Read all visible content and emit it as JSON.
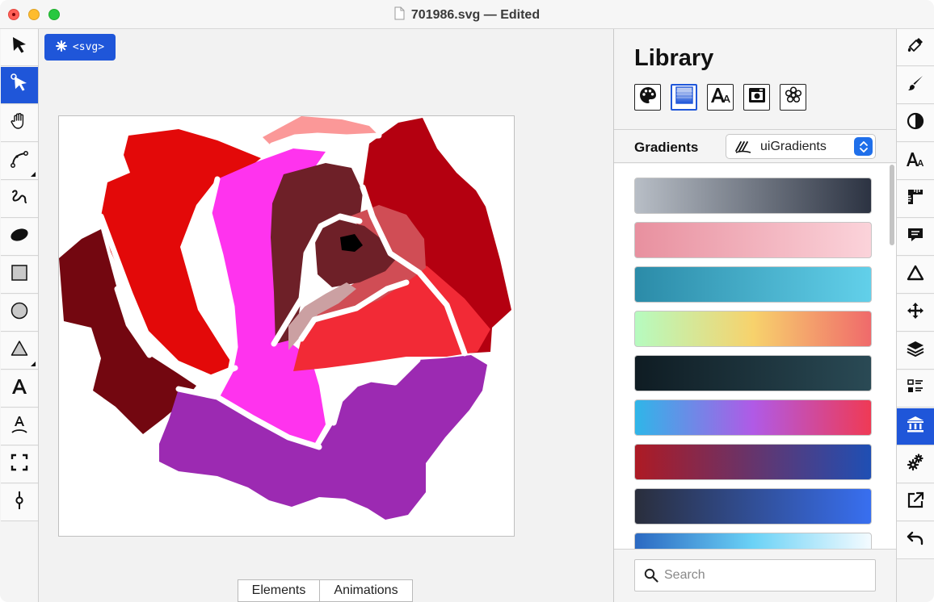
{
  "window": {
    "title": "701986.svg — Edited"
  },
  "left_toolbar": {
    "tools": [
      {
        "name": "select-arrow",
        "icon": "arrow-pointer-icon",
        "active": false
      },
      {
        "name": "node-select",
        "icon": "node-pointer-icon",
        "active": true
      },
      {
        "name": "pan-hand",
        "icon": "hand-icon",
        "active": false
      },
      {
        "name": "pen",
        "icon": "bezier-pen-icon",
        "active": false
      },
      {
        "name": "freehand",
        "icon": "squiggle-icon",
        "active": false
      },
      {
        "name": "ellipse",
        "icon": "ellipse-icon",
        "active": false
      },
      {
        "name": "rectangle",
        "icon": "rectangle-icon",
        "active": false
      },
      {
        "name": "circle",
        "icon": "circle-icon",
        "active": false
      },
      {
        "name": "polygon",
        "icon": "triangle-icon",
        "active": false
      },
      {
        "name": "text",
        "icon": "text-icon",
        "active": false
      },
      {
        "name": "text-path",
        "icon": "text-on-path-icon",
        "active": false
      },
      {
        "name": "zoom-fit",
        "icon": "fit-frame-icon",
        "active": false
      },
      {
        "name": "gradient-stop",
        "icon": "stop-handle-icon",
        "active": false
      }
    ]
  },
  "canvas": {
    "element_chip": "<svg>",
    "bottom_tabs": [
      "Elements",
      "Animations"
    ]
  },
  "library": {
    "title": "Library",
    "categories": [
      {
        "name": "colors",
        "icon": "palette-icon",
        "active": false
      },
      {
        "name": "gradients",
        "icon": "gradient-swatch-icon",
        "active": true
      },
      {
        "name": "fonts",
        "icon": "font-icon",
        "active": false
      },
      {
        "name": "images",
        "icon": "image-icon",
        "active": false
      },
      {
        "name": "symbols",
        "icon": "flower-icon",
        "active": false
      }
    ],
    "section_label": "Gradients",
    "source_select": "uiGradients",
    "search_placeholder": "Search",
    "gradients": [
      {
        "from": "#b8bec6",
        "to": "#2c3342"
      },
      {
        "from": "#e8909f",
        "to": "#fbd3da"
      },
      {
        "from": "#2b8ba8",
        "to": "#62d0ea"
      },
      {
        "from": "#b6fbc0",
        "mid": "#f7d26c",
        "to": "#f06a6b"
      },
      {
        "from": "#0f1c23",
        "to": "#2a4a55"
      },
      {
        "from": "#2fb6e8",
        "mid": "#b05ae6",
        "to": "#ef3a55"
      },
      {
        "from": "#ad1a24",
        "to": "#1f4fb4"
      },
      {
        "from": "#2a2e3c",
        "to": "#386ff0"
      },
      {
        "from": "#2b69c2",
        "mid": "#6bd2f6",
        "to": "#f4fbff"
      }
    ]
  },
  "right_toolbar": {
    "tools": [
      {
        "name": "fill",
        "icon": "paint-bucket-icon",
        "active": false
      },
      {
        "name": "stroke",
        "icon": "brush-icon",
        "active": false
      },
      {
        "name": "opacity",
        "icon": "contrast-icon",
        "active": false
      },
      {
        "name": "typography",
        "icon": "font-size-icon",
        "active": false
      },
      {
        "name": "measure",
        "icon": "ruler-icon",
        "active": false
      },
      {
        "name": "comments",
        "icon": "speech-bubble-icon",
        "active": false
      },
      {
        "name": "shape",
        "icon": "triangle-outline-icon",
        "active": false
      },
      {
        "name": "transform",
        "icon": "move-arrows-icon",
        "active": false
      },
      {
        "name": "layers",
        "icon": "layers-icon",
        "active": false
      },
      {
        "name": "outline",
        "icon": "list-icon",
        "active": false
      },
      {
        "name": "library",
        "icon": "bank-icon",
        "active": true
      },
      {
        "name": "settings",
        "icon": "gears-icon",
        "active": false
      },
      {
        "name": "export",
        "icon": "export-icon",
        "active": false
      },
      {
        "name": "undo",
        "icon": "undo-icon",
        "active": false
      }
    ]
  },
  "colors": {
    "accent": "#1f56d9"
  }
}
